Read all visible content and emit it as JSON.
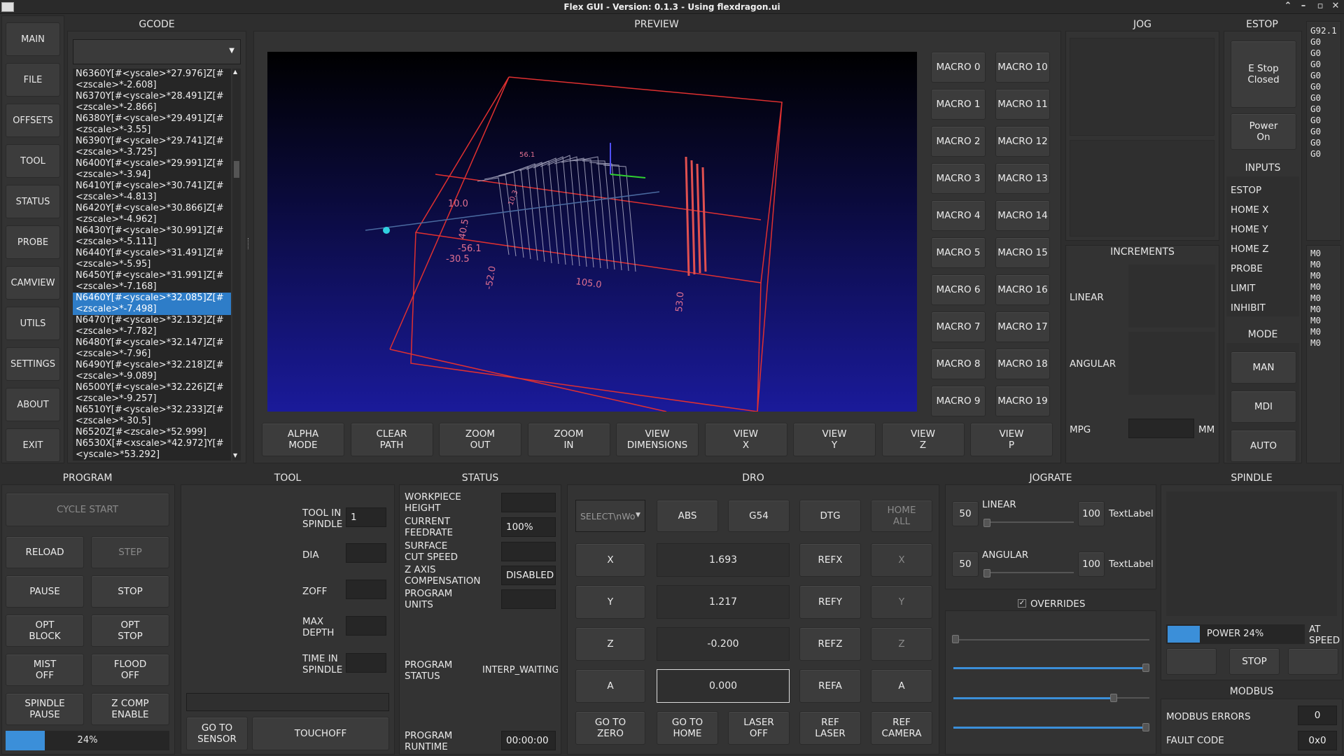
{
  "title": "Flex GUI - Version: 0.1.3 - Using flexdragon.ui",
  "nav": [
    "MAIN",
    "FILE",
    "OFFSETS",
    "TOOL",
    "STATUS",
    "PROBE",
    "CAMVIEW",
    "UTILS",
    "SETTINGS",
    "ABOUT",
    "EXIT"
  ],
  "sections": {
    "gcode": "GCODE",
    "preview": "PREVIEW",
    "jog": "JOG",
    "estop": "ESTOP",
    "increments": "INCREMENTS",
    "inputs": "INPUTS",
    "mode": "MODE",
    "program": "PROGRAM",
    "tool": "TOOL",
    "status": "STATUS",
    "dro": "DRO",
    "jograte": "JOGRATE",
    "spindle": "SPINDLE",
    "modbus": "MODBUS"
  },
  "gcode_lines": [
    "N6360Y[#<yscale>*27.976]Z[#",
    "<zscale>*-2.608]",
    "N6370Y[#<yscale>*28.491]Z[#",
    "<zscale>*-2.866]",
    "N6380Y[#<yscale>*29.491]Z[#",
    "<zscale>*-3.55]",
    "N6390Y[#<yscale>*29.741]Z[#",
    "<zscale>*-3.725]",
    "N6400Y[#<yscale>*29.991]Z[#",
    "<zscale>*-3.94]",
    "N6410Y[#<yscale>*30.741]Z[#",
    "<zscale>*-4.813]",
    "N6420Y[#<yscale>*30.866]Z[#",
    "<zscale>*-4.962]",
    "N6430Y[#<yscale>*30.991]Z[#",
    "<zscale>*-5.111]",
    "N6440Y[#<yscale>*31.491]Z[#",
    "<zscale>*-5.95]",
    "N6450Y[#<yscale>*31.991]Z[#",
    "<zscale>*-7.168]",
    "N6460Y[#<yscale>*32.085]Z[#",
    "<zscale>*-7.498]",
    "N6470Y[#<yscale>*32.132]Z[#",
    "<zscale>*-7.782]",
    "N6480Y[#<yscale>*32.147]Z[#",
    "<zscale>*-7.96]",
    "N6490Y[#<yscale>*32.218]Z[#",
    "<zscale>*-9.089]",
    "N6500Y[#<yscale>*32.226]Z[#",
    "<zscale>*-9.257]",
    "N6510Y[#<yscale>*32.233]Z[#",
    "<zscale>*-30.5]",
    "N6520Z[#<zscale>*52.999]",
    "N6530X[#<xscale>*42.972]Y[#",
    "<yscale>*53.292]"
  ],
  "gcode_selected": [
    20,
    21
  ],
  "preview_buttons": [
    "ALPHA\nMODE",
    "CLEAR\nPATH",
    "ZOOM\nOUT",
    "ZOOM\nIN",
    "VIEW\nDIMENSIONS",
    "VIEW\nX",
    "VIEW\nY",
    "VIEW\nZ",
    "VIEW\nP"
  ],
  "preview_labels": {
    "d1": "10.0",
    "d2": "40.5",
    "d3": "-56.1",
    "d4": "-30.5",
    "d5": "-52.0",
    "d6": "105.0",
    "d7": "53.0",
    "d8": "56.1",
    "d9": "10.3"
  },
  "macros_left": [
    "MACRO 0",
    "MACRO 1",
    "MACRO 2",
    "MACRO 3",
    "MACRO 4",
    "MACRO 5",
    "MACRO 6",
    "MACRO 7",
    "MACRO 8",
    "MACRO 9"
  ],
  "macros_right": [
    "MACRO 10",
    "MACRO 11",
    "MACRO 12",
    "MACRO 13",
    "MACRO 14",
    "MACRO 15",
    "MACRO 16",
    "MACRO 17",
    "MACRO 18",
    "MACRO 19"
  ],
  "increments": {
    "linear": "LINEAR",
    "angular": "ANGULAR",
    "mpg": "MPG",
    "mm": "MM"
  },
  "estop": {
    "estop_btn": "E Stop\nClosed",
    "power_btn": "Power\nOn"
  },
  "inputs": [
    "ESTOP",
    "HOME X",
    "HOME Y",
    "HOME Z",
    "PROBE",
    "LIMIT",
    "INHIBIT"
  ],
  "modes": [
    "MAN",
    "MDI",
    "AUTO"
  ],
  "gcodes_active": [
    "G92.1",
    "G0",
    "G0",
    "G0",
    "G0",
    "G0",
    "G0",
    "G0",
    "G0",
    "G0",
    "G0",
    "G0"
  ],
  "mcodes_active": [
    "M0",
    "M0",
    "M0",
    "M0",
    "M0",
    "M0",
    "M0",
    "M0",
    "M0"
  ],
  "program": {
    "cycle_start": "CYCLE START",
    "reload": "RELOAD",
    "step": "STEP",
    "pause": "PAUSE",
    "stop": "STOP",
    "opt_block": "OPT\nBLOCK",
    "opt_stop": "OPT\nSTOP",
    "mist": "MIST\nOFF",
    "flood": "FLOOD\nOFF",
    "spindle_pause": "SPINDLE\nPAUSE",
    "zcomp": "Z COMP\nENABLE",
    "progress": "24%",
    "progress_value": 0.24
  },
  "tool": {
    "tool_in_spindle": "TOOL IN\nSPINDLE",
    "tool_value": "1",
    "dia": "DIA",
    "zoff": "ZOFF",
    "max_depth": "MAX\nDEPTH",
    "time_in_spindle": "TIME IN\nSPINDLE",
    "go_to_sensor": "GO TO\nSENSOR",
    "touchoff": "TOUCHOFF"
  },
  "status": {
    "workpiece_height": "WORKPIECE\nHEIGHT",
    "current_feedrate": "CURRENT\nFEEDRATE",
    "feedrate_value": "100%",
    "surface_cut": "SURFACE\nCUT SPEED",
    "zaxis_comp": "Z AXIS\nCOMPENSATION",
    "zaxis_value": "DISABLED",
    "program_units": "PROGRAM\nUNITS",
    "program_status": "PROGRAM\nSTATUS",
    "program_status_value": "INTERP_WAITING",
    "program_runtime": "PROGRAM\nRUNTIME",
    "runtime_value": "00:00:00"
  },
  "dro": {
    "select": "SELECT\\nWo",
    "abs": "ABS",
    "g54": "G54",
    "dtg": "DTG",
    "home_all": "HOME\nALL",
    "axes": [
      "X",
      "Y",
      "Z",
      "A"
    ],
    "values": [
      "1.693",
      "1.217",
      "-0.200",
      "0.000"
    ],
    "refs": [
      "REFX",
      "REFY",
      "REFZ",
      "REFA"
    ],
    "go_zero": "GO TO\nZERO",
    "go_home": "GO TO\nHOME",
    "laser_off": "LASER\nOFF",
    "ref_laser": "REF\nLASER",
    "ref_camera": "REF\nCAMERA"
  },
  "jograte": {
    "linear": "LINEAR",
    "angular": "ANGULAR",
    "min": "50",
    "max": "100",
    "textlabel": "TextLabel",
    "overrides": "OVERRIDES",
    "overrides_check": "✓"
  },
  "spindle": {
    "power": "POWER 24%",
    "power_value": 0.24,
    "at_speed": "AT\nSPEED",
    "stop": "STOP"
  },
  "modbus": {
    "errors_label": "MODBUS ERRORS",
    "errors_value": "0",
    "fault_label": "FAULT CODE",
    "fault_value": "0x0"
  },
  "colors": {
    "accent": "#3b8fd9",
    "selected": "#2e7dc8",
    "path": "#e03030"
  }
}
